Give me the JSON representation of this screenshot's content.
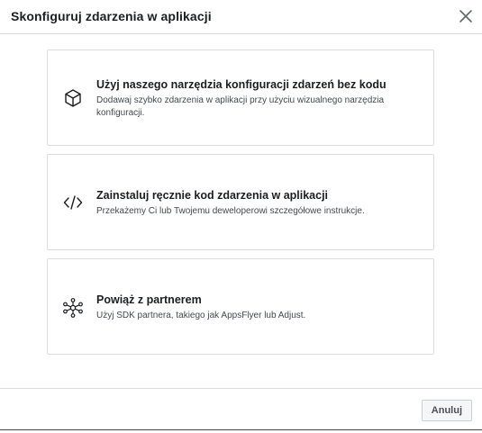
{
  "dialog": {
    "title": "Skonfiguruj zdarzenia w aplikacji",
    "close_icon": "close-icon"
  },
  "options": [
    {
      "icon": "cube-icon",
      "title": "Użyj naszego narzędzia konfiguracji zdarzeń bez kodu",
      "description": "Dodawaj szybko zdarzenia w aplikacji przy użyciu wizualnego narzędzia konfiguracji."
    },
    {
      "icon": "code-icon",
      "title": "Zainstaluj ręcznie kod zdarzenia w aplikacji",
      "description": "Przekażemy Ci lub Twojemu deweloperowi szczegółowe instrukcje."
    },
    {
      "icon": "network-icon",
      "title": "Powiąż z partnerem",
      "description": "Użyj SDK partnera, takiego jak AppsFlyer lub Adjust."
    }
  ],
  "footer": {
    "cancel_label": "Anuluj"
  },
  "colors": {
    "border": "#dadde1",
    "text": "#1c1e21",
    "secondary_text": "#444950",
    "button_bg": "#f5f6f7"
  }
}
